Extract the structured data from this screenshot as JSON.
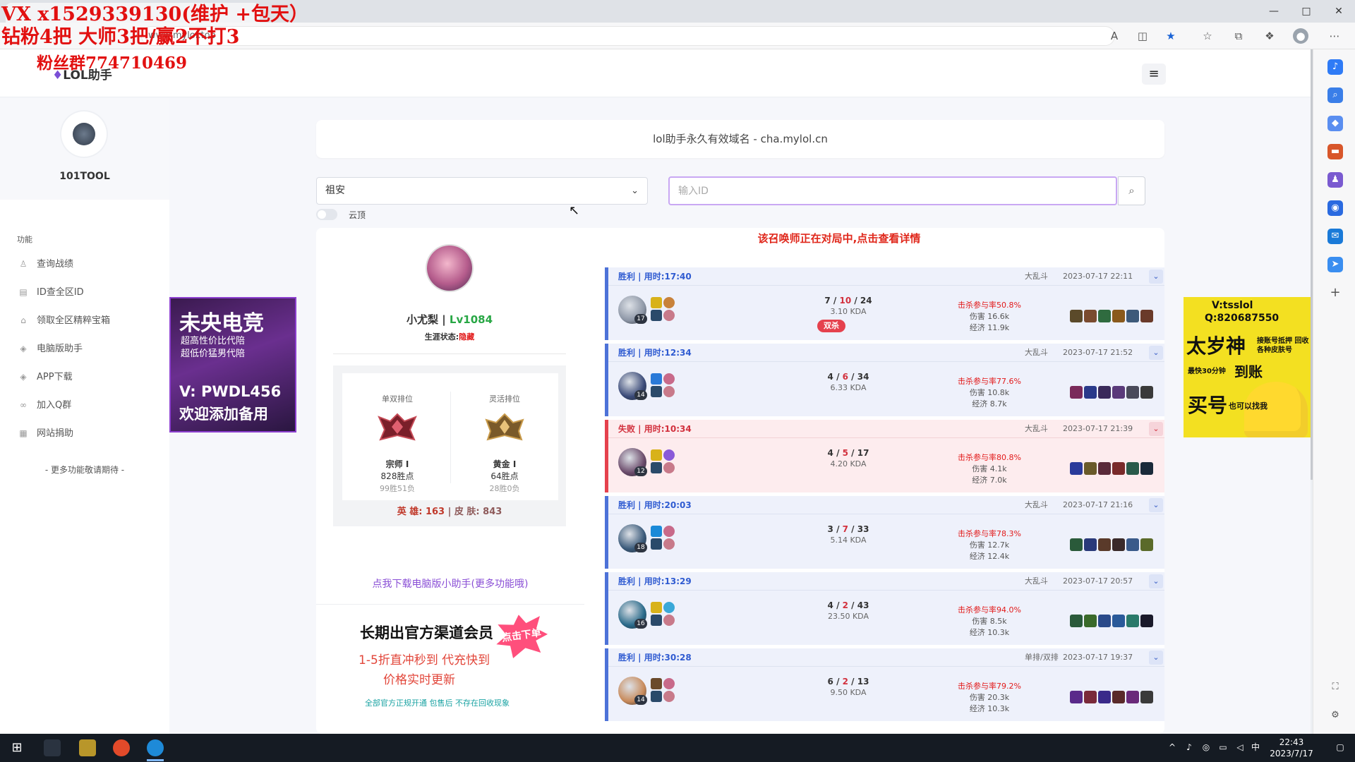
{
  "browser": {
    "url": "www.mylol.top",
    "window_controls": [
      "—",
      "□",
      "✕"
    ]
  },
  "overlay": {
    "line1": "VX x1529339130(维护 +包天）",
    "line2": "钻粉4把 大师3把/赢2不打3",
    "line3": "粉丝群774710469"
  },
  "header": {
    "logo": "LOL助手",
    "menu_icon": "≡"
  },
  "sidebar": {
    "username": "101TOOL",
    "section": "功能",
    "items": [
      {
        "label": "查询战绩",
        "icon": "user-icon"
      },
      {
        "label": "ID查全区ID",
        "icon": "book-icon"
      },
      {
        "label": "领取全区精粹宝箱",
        "icon": "chest-icon"
      },
      {
        "label": "电脑版助手",
        "icon": "layers-icon"
      },
      {
        "label": "APP下载",
        "icon": "layers-icon"
      },
      {
        "label": "加入Q群",
        "icon": "link-icon"
      },
      {
        "label": "网站捐助",
        "icon": "grid-icon"
      }
    ],
    "more": "- 更多功能敬请期待 -"
  },
  "ads": {
    "left": {
      "title": "未央电竞",
      "line1": "超高性价比代陪",
      "line2": "超低价猛男代陪",
      "line3": "V: PWDL456",
      "line4": "欢迎添加备用"
    },
    "right": {
      "line1": "V:tsslol",
      "line2": "Q:820687550",
      "title": "太岁神",
      "sub": "接账号抵押 回收各种皮肤号",
      "line3": "最快30分钟",
      "line3b": "到账",
      "title2": "买号",
      "sub2": "也可以找我"
    },
    "vip": {
      "title": "长期出官方渠道会员",
      "badge": "点击下单",
      "line1": "1-5折直冲秒到 代充快到",
      "line2": "价格实时更新",
      "line3": "全部官方正规开通 包售后 不存在回收现象"
    }
  },
  "banner": "lol助手永久有效域名 - cha.mylol.cn",
  "search": {
    "region": "祖安",
    "placeholder": "输入ID",
    "toggle_label": "云顶"
  },
  "in_game_notice": "该召唤师正在对局中,点击查看详情",
  "profile": {
    "name": "小尤梨",
    "sep": " | ",
    "level": "Lv1084",
    "career_label": "生涯状态:",
    "career_value": "隐藏",
    "solo": {
      "title": "单双排位",
      "tier": "宗师 I",
      "points": "828胜点",
      "wl": "99胜51负"
    },
    "flex": {
      "title": "灵活排位",
      "tier": "黄金 I",
      "points": "64胜点",
      "wl": "28胜0负"
    },
    "champ_label": "英 雄: ",
    "champ_count": "163",
    "skin_label": " | 皮 肤: ",
    "skin_count": "843",
    "download_link": "点我下载电脑版小助手(更多功能哦)"
  },
  "matches": [
    {
      "result": "胜利 | 用时:17:40",
      "outcome": "win",
      "mode": "大乱斗",
      "date": "2023-07-17 22:11",
      "level": "17",
      "k": "7",
      "d": "10",
      "a": "24",
      "kda": "3.10 KDA",
      "multi": "双杀",
      "kp": "击杀参与率50.8%",
      "dmg": "伤害 16.6k",
      "gold": "经济 11.9k",
      "champ_color": "#8d96a6",
      "items": [
        "#5b4a2a",
        "#7a4b2f",
        "#2f6b3f",
        "#8a5a1c",
        "#3d5a7a",
        "#6a3a2a"
      ]
    },
    {
      "result": "胜利 | 用时:12:34",
      "outcome": "win",
      "mode": "大乱斗",
      "date": "2023-07-17 21:52",
      "level": "14",
      "k": "4",
      "d": "6",
      "a": "34",
      "kda": "6.33 KDA",
      "multi": "",
      "kp": "击杀参与率77.6%",
      "dmg": "伤害 10.8k",
      "gold": "经济 8.7k",
      "champ_color": "#3a4a78",
      "items": [
        "#7a2a5a",
        "#2a3a8a",
        "#3a2a5a",
        "#5a3a7a",
        "#4a4a5a",
        "#3a3a3a"
      ]
    },
    {
      "result": "失败 | 用时:10:34",
      "outcome": "loss",
      "mode": "大乱斗",
      "date": "2023-07-17 21:39",
      "level": "12",
      "k": "4",
      "d": "5",
      "a": "17",
      "kda": "4.20 KDA",
      "multi": "",
      "kp": "击杀参与率80.8%",
      "dmg": "伤害 4.1k",
      "gold": "经济 7.0k",
      "champ_color": "#6a4a6a",
      "items": [
        "#2a3a9a",
        "#6a5a2a",
        "#5a2a3a",
        "#7a2a2a",
        "#2a5a4a",
        "#1a2a3a"
      ]
    },
    {
      "result": "胜利 | 用时:20:03",
      "outcome": "win",
      "mode": "大乱斗",
      "date": "2023-07-17 21:16",
      "level": "18",
      "k": "3",
      "d": "7",
      "a": "33",
      "kda": "5.14 KDA",
      "multi": "",
      "kp": "击杀参与率78.3%",
      "dmg": "伤害 12.7k",
      "gold": "经济 12.4k",
      "champ_color": "#3a5a7a",
      "items": [
        "#2a5a3a",
        "#2a3a7a",
        "#5a3a2a",
        "#3a2a2a",
        "#3a5a8a",
        "#5a6a2a"
      ]
    },
    {
      "result": "胜利 | 用时:13:29",
      "outcome": "win",
      "mode": "大乱斗",
      "date": "2023-07-17 20:57",
      "level": "16",
      "k": "4",
      "d": "2",
      "a": "43",
      "kda": "23.50 KDA",
      "multi": "",
      "kp": "击杀参与率94.0%",
      "dmg": "伤害 8.5k",
      "gold": "经济 10.3k",
      "champ_color": "#2a6a8a",
      "items": [
        "#2a5a3a",
        "#3a6a2a",
        "#2a4a8a",
        "#2a5a9a",
        "#2a7a6a",
        "#1a1a2a"
      ]
    },
    {
      "result": "胜利 | 用时:30:28",
      "outcome": "win",
      "mode": "单排/双排",
      "date": "2023-07-17 19:37",
      "level": "14",
      "k": "6",
      "d": "2",
      "a": "13",
      "kda": "9.50 KDA",
      "multi": "",
      "kp": "击杀参与率79.2%",
      "dmg": "伤害 20.3k",
      "gold": "经济 10.3k",
      "champ_color": "#c88a5a",
      "items": [
        "#5a2a8a",
        "#7a2a3a",
        "#3a2a8a",
        "#5a2a2a",
        "#6a2a7a",
        "#3a3a3a"
      ]
    }
  ],
  "taskbar": {
    "time": "22:43",
    "date": "2023/7/17",
    "ime": "中"
  }
}
